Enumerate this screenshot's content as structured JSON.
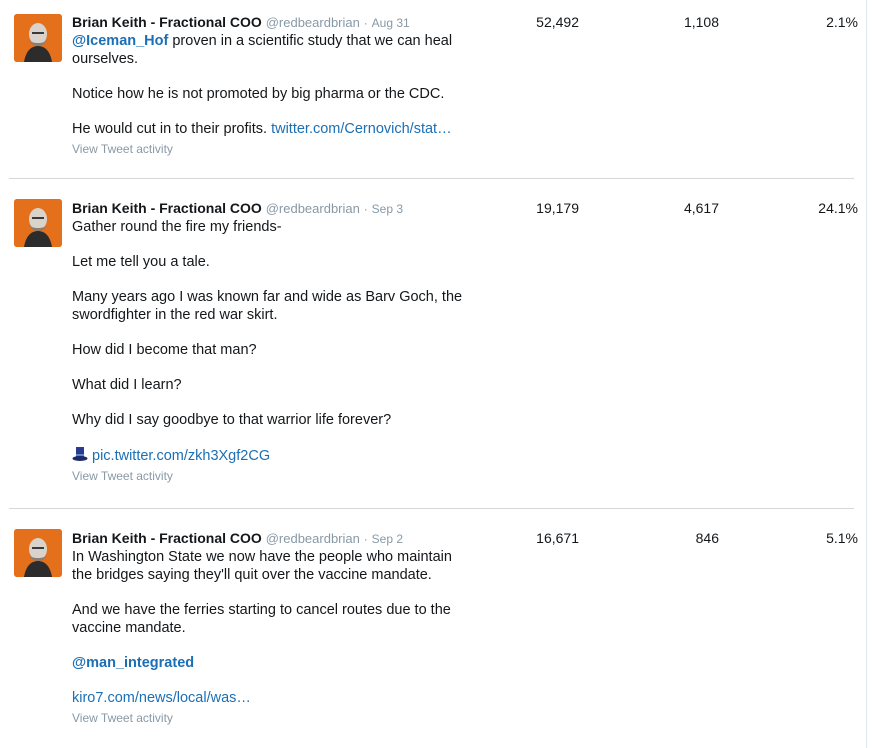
{
  "tweets": [
    {
      "name": "Brian Keith - Fractional COO",
      "handle": "@redbeardbrian",
      "separator": "·",
      "date": "Aug 31",
      "mention": "@Iceman_Hof",
      "line1_rest": " proven in a scientific study that we can heal ourselves.",
      "para2": "Notice how he is not promoted by big pharma or the CDC.",
      "para3_text": "He would cut in to their profits. ",
      "para3_link": "twitter.com/Cernovich/stat…",
      "activity": "View Tweet activity",
      "impressions": "52,492",
      "engagements": "1,108",
      "engagement_rate": "2.1%"
    },
    {
      "name": "Brian Keith - Fractional COO",
      "handle": "@redbeardbrian",
      "separator": "·",
      "date": "Sep 3",
      "paras": [
        "Gather round the fire my friends-",
        "Let me tell you a tale.",
        "Many years ago I was known far and wide as Barv Goch, the swordfighter in the red war skirt.",
        "How did I become that man?",
        "What did I learn?",
        "Why did I say goodbye to that warrior life forever?"
      ],
      "pic_link": "pic.twitter.com/zkh3Xgf2CG",
      "activity": "View Tweet activity",
      "impressions": "19,179",
      "engagements": "4,617",
      "engagement_rate": "24.1%"
    },
    {
      "name": "Brian Keith - Fractional COO",
      "handle": "@redbeardbrian",
      "separator": "·",
      "date": "Sep 2",
      "para1": "In Washington State we now have the people who maintain the bridges saying they'll quit over the vaccine mandate.",
      "para2": "And we have the ferries starting to cancel routes due to the vaccine mandate.",
      "mention": "@man_integrated",
      "link": "kiro7.com/news/local/was…",
      "activity": "View Tweet activity",
      "impressions": "16,671",
      "engagements": "846",
      "engagement_rate": "5.1%"
    }
  ]
}
